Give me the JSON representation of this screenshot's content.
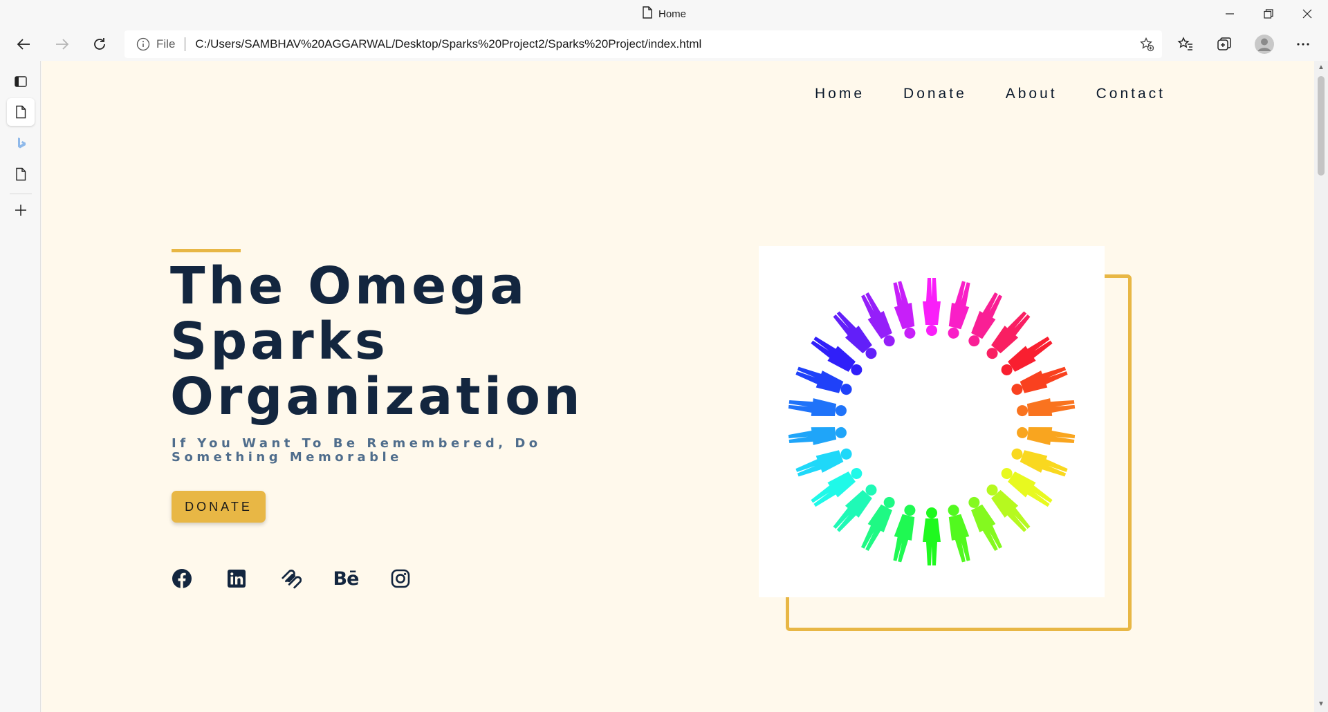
{
  "browser": {
    "tab_title": "Home",
    "address": {
      "scheme_label": "File",
      "url": "C:/Users/SAMBHAV%20AGGARWAL/Desktop/Sparks%20Project2/Sparks%20Project/index.html"
    }
  },
  "site": {
    "nav": [
      "Home",
      "Donate",
      "About",
      "Contact"
    ],
    "hero": {
      "title_lines": [
        "The Omega",
        "Sparks",
        "Organization"
      ],
      "subtitle": "If You Want To Be Remembered, Do Something Memorable",
      "cta_label": "DONATE"
    },
    "socials": {
      "behance_text": "Bē",
      "icons": [
        "facebook-icon",
        "linkedin-icon",
        "squarespace-icon",
        "behance-icon",
        "instagram-icon"
      ]
    }
  },
  "colors": {
    "page_background": "#fff9ec",
    "accent": "#e8b745",
    "heading": "#13263f",
    "subtitle": "#4f6d8c"
  }
}
